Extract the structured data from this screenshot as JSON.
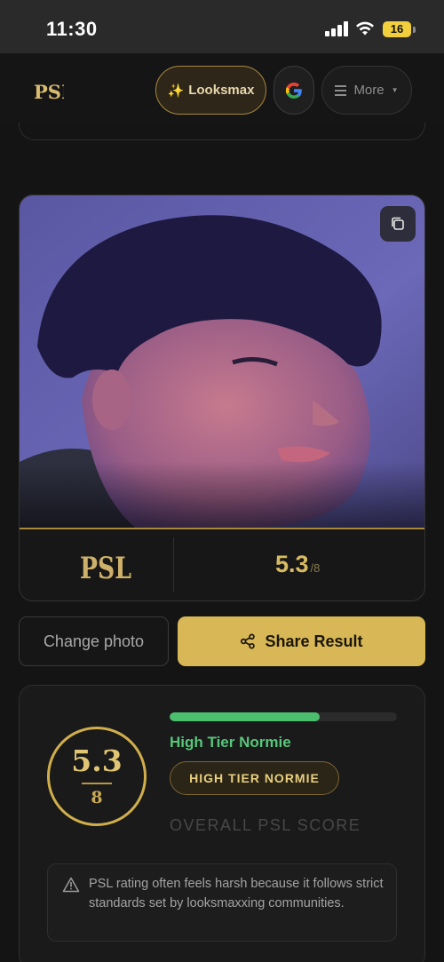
{
  "status_bar": {
    "time": "11:30",
    "battery": "16"
  },
  "header": {
    "logo": "PSL",
    "looksmax_label": "Looksmax",
    "more_label": "More"
  },
  "result_card": {
    "logo": "PSL",
    "score": "5.3",
    "score_max": "/8"
  },
  "actions": {
    "change_photo_label": "Change photo",
    "share_label": "Share Result"
  },
  "score_panel": {
    "score": "5.3",
    "max": "8",
    "progress_fraction": 0.66,
    "tier_name": "High Tier Normie",
    "tier_badge": "HIGH TIER NORMIE",
    "overall_label": "OVERALL PSL SCORE",
    "notice": "PSL rating often feels harsh because it follows strict standards set by looksmaxxing communities."
  },
  "colors": {
    "gold_accent": "#d8b757",
    "tier_green": "#4cbf6f",
    "background": "#141414"
  },
  "icons": [
    "sparkle-icon",
    "google-icon",
    "menu-icon",
    "chevron-down-icon",
    "copy-icon",
    "share-icon",
    "warning-icon"
  ]
}
